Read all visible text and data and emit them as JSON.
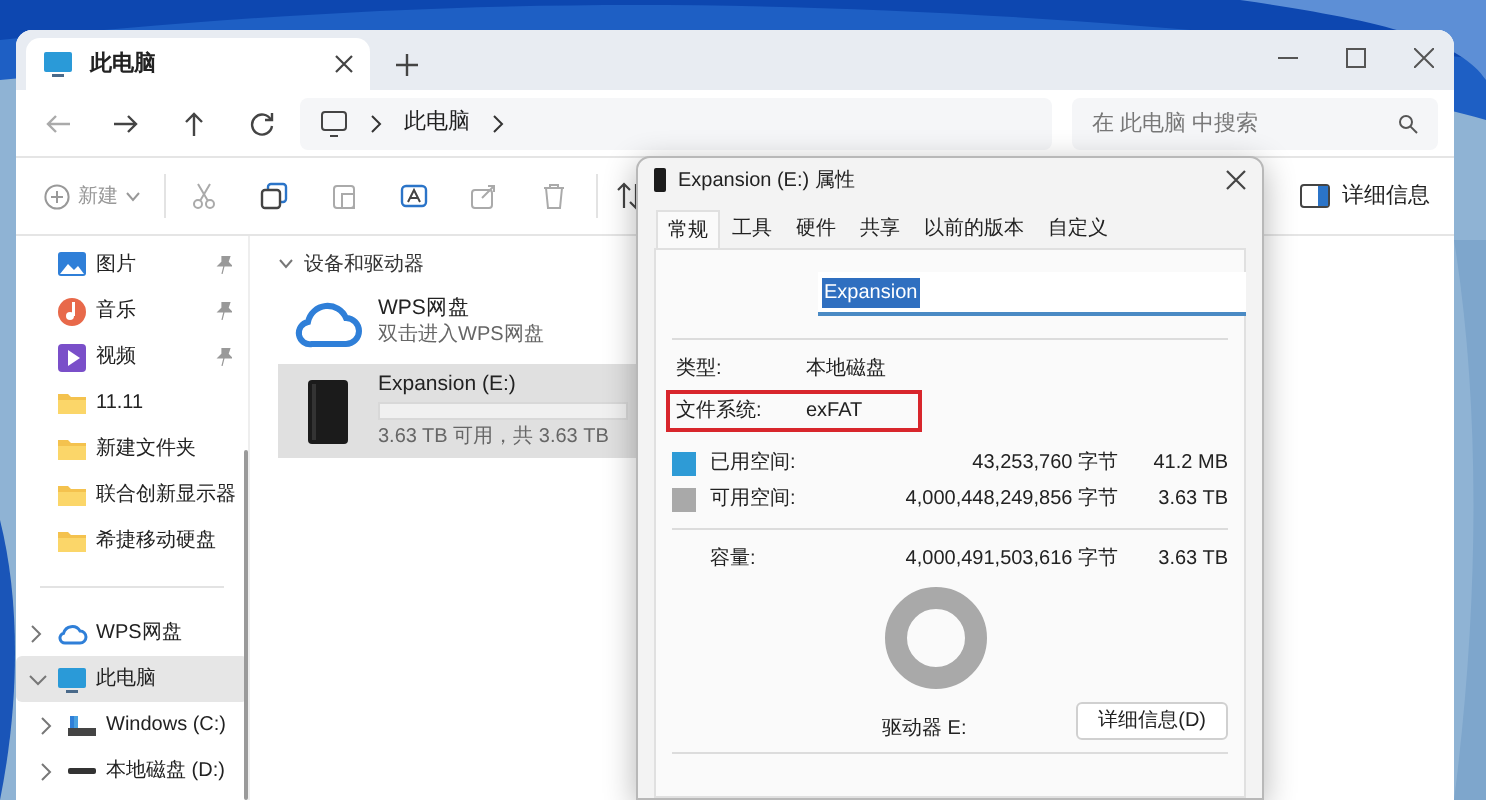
{
  "explorer": {
    "tabs": [
      {
        "label": "此电脑",
        "selected": true
      }
    ],
    "address": {
      "path": [
        "此电脑"
      ]
    },
    "search": {
      "placeholder": "在 此电脑 中搜索"
    },
    "toolbar": {
      "new_label": "新建",
      "details_label": "详细信息"
    },
    "sidebar": {
      "quick_access": [
        {
          "label": "图片",
          "kind": "pictures",
          "pinned": true
        },
        {
          "label": "音乐",
          "kind": "music",
          "pinned": true
        },
        {
          "label": "视频",
          "kind": "video",
          "pinned": true
        },
        {
          "label": "11.11",
          "kind": "folder",
          "pinned": false
        },
        {
          "label": "新建文件夹",
          "kind": "folder",
          "pinned": false
        },
        {
          "label": "联合创新显示器",
          "kind": "folder",
          "pinned": false
        },
        {
          "label": "希捷移动硬盘",
          "kind": "folder",
          "pinned": false
        }
      ],
      "tree": [
        {
          "label": "WPS网盘",
          "kind": "cloud",
          "expanded": false,
          "selected": false
        },
        {
          "label": "此电脑",
          "kind": "pc",
          "expanded": true,
          "selected": true,
          "children": [
            {
              "label": "Windows (C:)",
              "kind": "system_drive",
              "expanded": false,
              "selected": false
            },
            {
              "label": "本地磁盘 (D:)",
              "kind": "drive",
              "expanded": false,
              "selected": false
            }
          ]
        }
      ]
    },
    "content": {
      "group": {
        "label": "设备和驱动器",
        "expanded": true
      },
      "items": [
        {
          "kind": "cloud",
          "name": "WPS网盘",
          "subtitle": "双击进入WPS网盘",
          "selected": false
        },
        {
          "kind": "drive",
          "name": "Expansion (E:)",
          "level": 0,
          "subtitle": "3.63 TB 可用，共 3.63 TB",
          "selected": true
        }
      ]
    }
  },
  "dialog": {
    "title": "Expansion (E:) 属性",
    "tabs": [
      {
        "label": "常规",
        "selected": true
      },
      {
        "label": "工具",
        "selected": false
      },
      {
        "label": "硬件",
        "selected": false
      },
      {
        "label": "共享",
        "selected": false
      },
      {
        "label": "以前的版本",
        "selected": false
      },
      {
        "label": "自定义",
        "selected": false
      }
    ],
    "name": "Expansion",
    "properties": [
      {
        "label": "类型:",
        "value": "本地磁盘",
        "highlighted": false
      },
      {
        "label": "文件系统:",
        "value": "exFAT",
        "highlighted": true
      }
    ],
    "space": [
      {
        "label": "已用空间:",
        "bytes": "43,253,760 字节",
        "size": "41.2 MB",
        "color": "#2e9bd6"
      },
      {
        "label": "可用空间:",
        "bytes": "4,000,448,249,856 字节",
        "size": "3.63 TB",
        "color": "#a9a9a9"
      }
    ],
    "capacity": {
      "label": "容量:",
      "bytes": "4,000,491,503,616 字节",
      "size": "3.63 TB"
    },
    "drive_label": "驱动器 E:",
    "details_button": "详细信息(D)"
  }
}
